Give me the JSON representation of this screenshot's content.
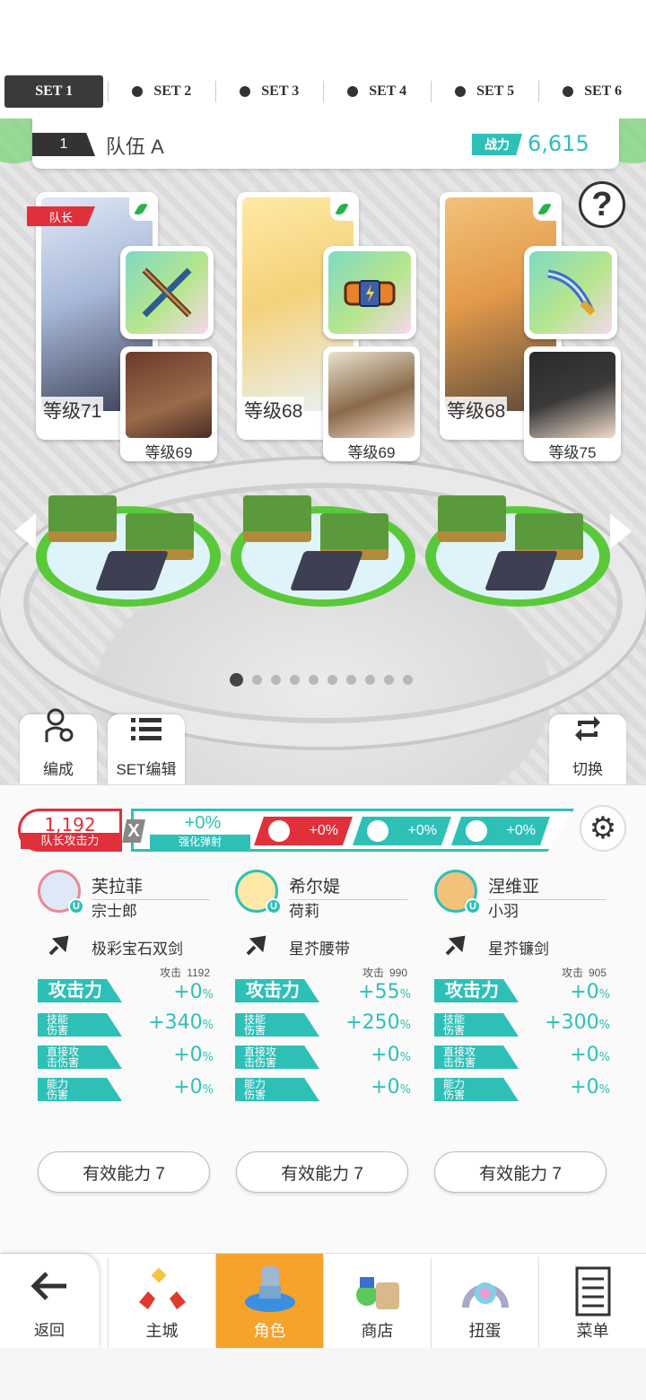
{
  "set_tabs": [
    {
      "label": "SET 1",
      "active": true
    },
    {
      "label": "SET 2",
      "active": false
    },
    {
      "label": "SET 3",
      "active": false
    },
    {
      "label": "SET 4",
      "active": false
    },
    {
      "label": "SET 5",
      "active": false
    },
    {
      "label": "SET 6",
      "active": false
    }
  ],
  "team": {
    "number": "1",
    "name": "队伍 A",
    "power_label": "战力",
    "power_value": "6,615"
  },
  "help_icon": "?",
  "leader_tag": "队长",
  "cards": [
    {
      "level": "等级71",
      "sub_level": "等级69"
    },
    {
      "level": "等级68",
      "sub_level": "等级69"
    },
    {
      "level": "等级68",
      "sub_level": "等级75"
    }
  ],
  "page_dots": {
    "count": 10,
    "active": 0
  },
  "tools": {
    "formation": "编成",
    "set_edit": "SET编辑",
    "switch": "切换"
  },
  "leader_attack": {
    "value": "1,192",
    "label": "队长攻击力"
  },
  "multiplier": "X",
  "boost": {
    "value": "+0%",
    "label": "强化弹射",
    "chips": [
      "+0%",
      "+0%",
      "+0%"
    ]
  },
  "columns": [
    {
      "name": "芙拉菲",
      "sub": "宗士郎",
      "weapon": "极彩宝石双剑",
      "atk_base_label": "攻击",
      "atk_base_value": "1192",
      "stats": [
        {
          "label": "攻击力",
          "num": "+0",
          "pct": "%"
        },
        {
          "label": "技能\n伤害",
          "num": "+340",
          "pct": "%"
        },
        {
          "label": "直接攻\n击伤害",
          "num": "+0",
          "pct": "%"
        },
        {
          "label": "能力\n伤害",
          "num": "+0",
          "pct": "%"
        }
      ],
      "effective": "有效能力 7"
    },
    {
      "name": "希尔媞",
      "sub": "荷莉",
      "weapon": "星芥腰带",
      "atk_base_label": "攻击",
      "atk_base_value": "990",
      "stats": [
        {
          "label": "攻击力",
          "num": "+55",
          "pct": "%"
        },
        {
          "label": "技能\n伤害",
          "num": "+250",
          "pct": "%"
        },
        {
          "label": "直接攻\n击伤害",
          "num": "+0",
          "pct": "%"
        },
        {
          "label": "能力\n伤害",
          "num": "+0",
          "pct": "%"
        }
      ],
      "effective": "有效能力 7"
    },
    {
      "name": "涅维亚",
      "sub": "小羽",
      "weapon": "星芥镰剑",
      "atk_base_label": "攻击",
      "atk_base_value": "905",
      "stats": [
        {
          "label": "攻击力",
          "num": "+0",
          "pct": "%"
        },
        {
          "label": "技能\n伤害",
          "num": "+300",
          "pct": "%"
        },
        {
          "label": "直接攻\n击伤害",
          "num": "+0",
          "pct": "%"
        },
        {
          "label": "能力\n伤害",
          "num": "+0",
          "pct": "%"
        }
      ],
      "effective": "有效能力 7"
    }
  ],
  "nav": {
    "back": "返回",
    "items": [
      {
        "label": "主城",
        "icon": "castle-icon",
        "active": false
      },
      {
        "label": "角色",
        "icon": "character-icon",
        "active": true
      },
      {
        "label": "商店",
        "icon": "shop-icon",
        "active": false
      },
      {
        "label": "扭蛋",
        "icon": "gacha-icon",
        "active": false
      },
      {
        "label": "菜单",
        "icon": "menu-icon",
        "active": false
      }
    ]
  },
  "colors": {
    "accent": "#2ec0b7",
    "leader_red": "#e0303c",
    "nav_active": "#f6a22b"
  }
}
